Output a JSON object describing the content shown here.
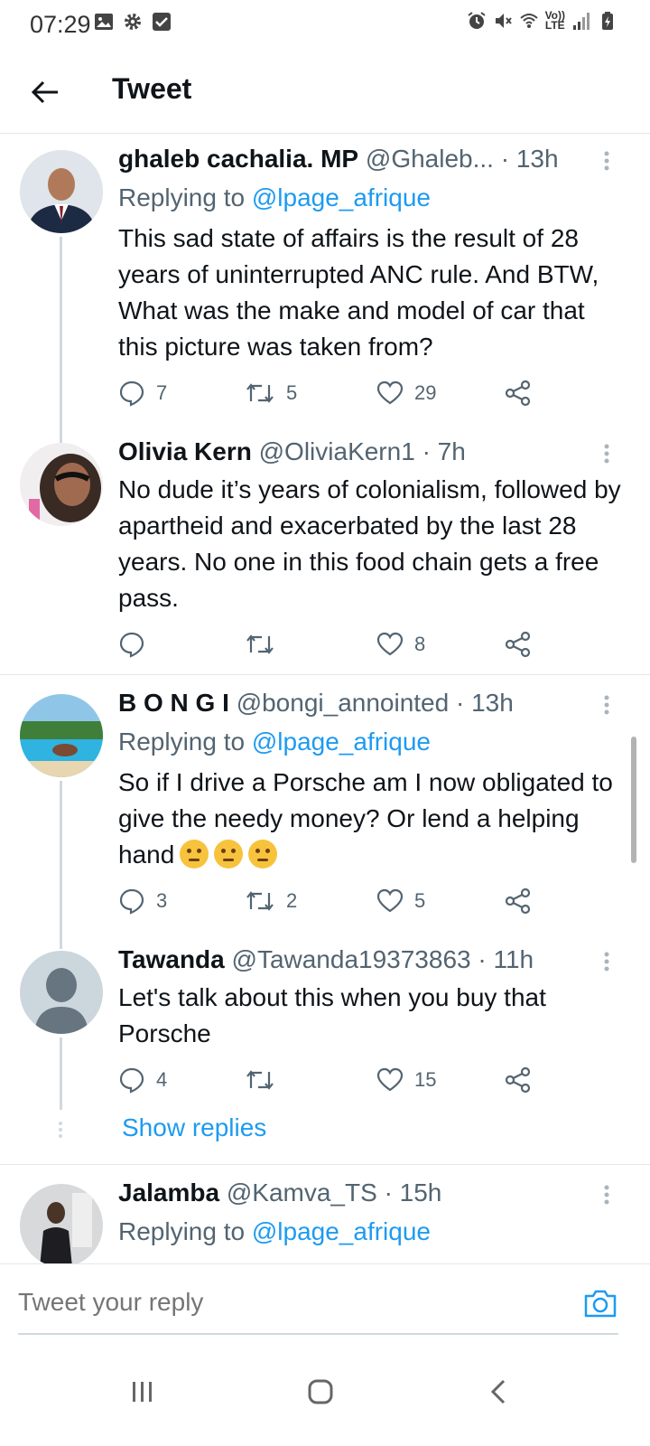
{
  "status_bar": {
    "time": "07:29",
    "left_icons": [
      "image-icon",
      "gear-icon",
      "checkbox-icon"
    ],
    "right_icons": [
      "alarm-icon",
      "mute-icon",
      "wifi-icon",
      "volte-icon",
      "signal-icon",
      "battery-icon"
    ],
    "lte_line1": "Vo))",
    "lte_line2": "LTE"
  },
  "header": {
    "title": "Tweet"
  },
  "tweets": [
    {
      "name": "ghaleb cachalia. MP",
      "handle": "@Ghaleb...",
      "time": "· 13h",
      "replying_prefix": "Replying to ",
      "replying_to": "@lpage_afrique",
      "text": "This sad state of affairs is the result of 28 years of uninterrupted ANC rule. And BTW, What was the make and model of car that this picture was taken from?",
      "replies": "7",
      "retweets": "5",
      "likes": "29"
    },
    {
      "name": "Olivia Kern",
      "handle": "@OliviaKern1",
      "time": "· 7h",
      "text": "No dude it’s years of colonialism, followed by apartheid and exacerbated by the last 28 years. No one in this food chain gets a free pass.",
      "replies": "",
      "retweets": "",
      "likes": "8"
    },
    {
      "name": "B O N G I",
      "handle": "@bongi_annointed",
      "time": "· 13h",
      "replying_prefix": "Replying to ",
      "replying_to": "@lpage_afrique",
      "text": "So if I drive a Porsche am I now obligated to give the needy money? Or lend a helping hand",
      "replies": "3",
      "retweets": "2",
      "likes": "5"
    },
    {
      "name": "Tawanda",
      "handle": "@Tawanda19373863",
      "time": "· 11h",
      "text": "Let's talk about this when you buy that Porsche",
      "replies": "4",
      "retweets": "",
      "likes": "15"
    },
    {
      "name": "Jalamba",
      "handle": "@Kamva_TS",
      "time": "· 15h",
      "replying_prefix": "Replying to ",
      "replying_to": "@lpage_afrique"
    }
  ],
  "show_replies": "Show replies",
  "composer": {
    "placeholder": "Tweet your reply"
  },
  "colors": {
    "link": "#1d9bf0",
    "secondary_text": "#536471",
    "thread_line": "#cfd9de"
  }
}
